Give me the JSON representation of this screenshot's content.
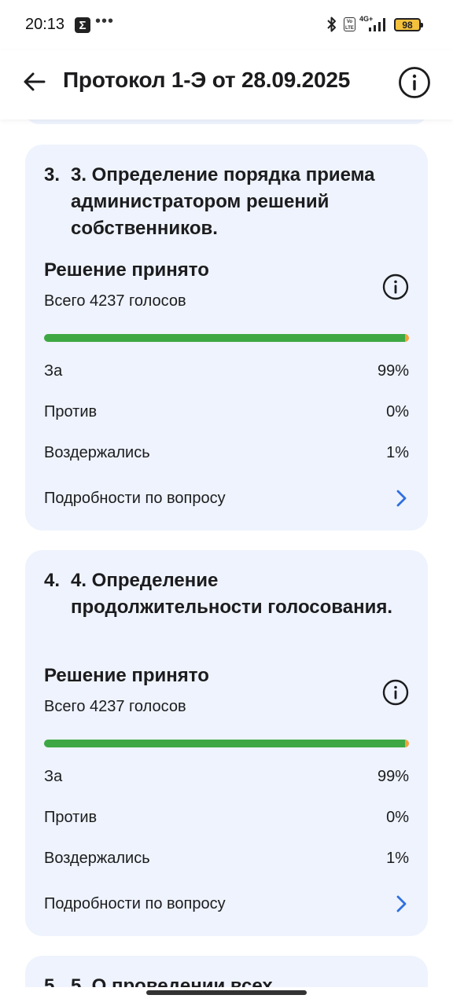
{
  "status_bar": {
    "time": "20:13",
    "notification_icon": "sigma-icon",
    "more_icon": "•••",
    "network_label": "4G+",
    "battery_level": "98",
    "icons": [
      "bluetooth-icon",
      "volte-icon",
      "signal-icon",
      "battery-icon"
    ]
  },
  "header": {
    "title": "Протокол 1-Э от 28.09.2025",
    "back_icon": "arrow-left-icon",
    "info_icon": "info-icon"
  },
  "colors": {
    "card_background": "#eef3fd",
    "for": "#3da843",
    "against": "#e0473e",
    "abstain": "#f2a33a",
    "chevron": "#2f6fe0"
  },
  "questions": [
    {
      "number": "3.",
      "title": "3. Определение порядка приема администратором решений собственников.",
      "status": "Решение принято",
      "total_votes": "Всего 4237 голосов",
      "for_label": "За",
      "for_value": "99%",
      "against_label": "Против",
      "against_value": "0%",
      "abstain_label": "Воздержались",
      "abstain_value": "1%",
      "bar_fractions": {
        "for": 0.99,
        "against": 0.0,
        "abstain": 0.01
      },
      "details_label": "Подробности по вопросу"
    },
    {
      "number": "4.",
      "title": "4. Определение продолжительности голосования.",
      "status": "Решение принято",
      "total_votes": "Всего 4237 голосов",
      "for_label": "За",
      "for_value": "99%",
      "against_label": "Против",
      "against_value": "0%",
      "abstain_label": "Воздержались",
      "abstain_value": "1%",
      "bar_fractions": {
        "for": 0.99,
        "against": 0.0,
        "abstain": 0.01
      },
      "details_label": "Подробности по вопросу"
    },
    {
      "number": "5.",
      "title": "5. О проведении всех"
    }
  ]
}
